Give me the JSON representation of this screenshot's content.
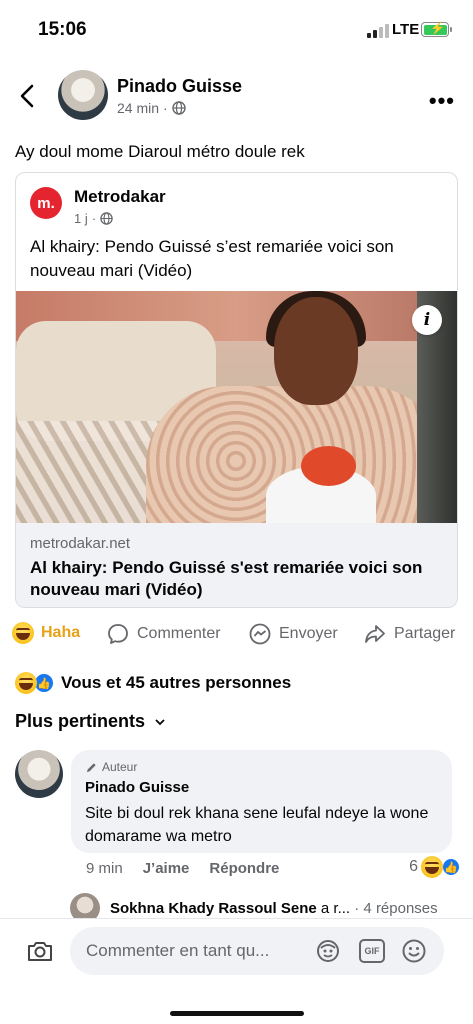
{
  "status_bar": {
    "time": "15:06",
    "network": "LTE"
  },
  "post": {
    "author": "Pinado Guisse",
    "time": "24 min",
    "text": "Ay doul mome Diaroul  métro  doule rek"
  },
  "shared": {
    "source_logo": "m.",
    "source_name": "Metrodakar",
    "source_time": "1 j",
    "caption": "Al khairy: Pendo Guissé s’est remariée voici son nouveau mari (Vidéo)",
    "link_domain": "metrodakar.net",
    "link_title": "Al khairy: Pendo Guissé s'est remariée voici son nouveau mari (Vidéo)",
    "info_label": "i"
  },
  "actions": {
    "haha": "Haha",
    "comment": "Commenter",
    "send": "Envoyer",
    "share": "Partager"
  },
  "reactions": {
    "summary": "Vous et 45 autres personnes"
  },
  "comments_sort": "Plus pertinents",
  "comment": {
    "badge": "Auteur",
    "author": "Pinado Guisse",
    "text": "Site bi doul rek khana sene  leufal ndeye la wone domarame  wa metro",
    "time": "9 min",
    "like": "J’aime",
    "reply": "Répondre",
    "reaction_count": "6"
  },
  "reply_preview": {
    "name": "Sokhna Khady Rassoul Sene",
    "rest": "a r...",
    "count": "· 4 réponses"
  },
  "composer": {
    "placeholder": "Commenter en tant qu..."
  },
  "colors": {
    "accent": "#1877f2",
    "haha": "#e7a218",
    "metro_red": "#e4242f"
  }
}
